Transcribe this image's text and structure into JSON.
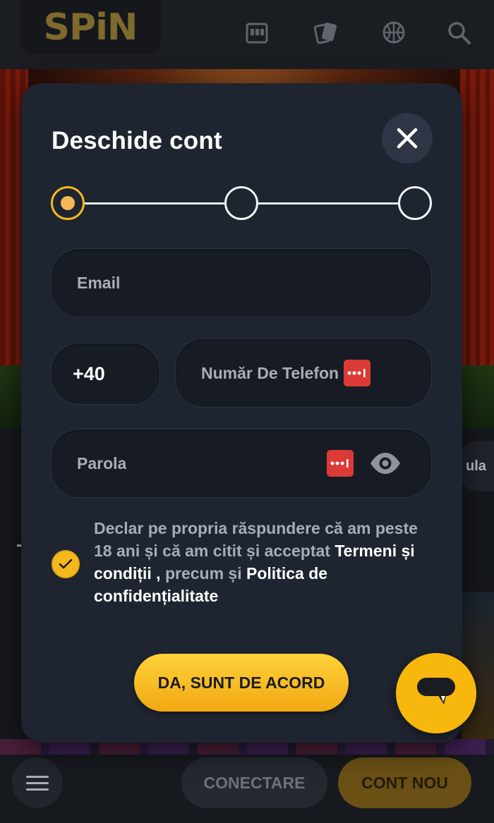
{
  "brand": {
    "logo_text": "SPiN"
  },
  "topbar": {
    "icons": [
      "slot-machine-icon",
      "cards-icon",
      "basketball-icon",
      "search-icon"
    ]
  },
  "modal": {
    "title": "Deschide cont",
    "stepper": {
      "current_step": 1,
      "total_steps": 3
    },
    "email": {
      "placeholder": "Email"
    },
    "phone": {
      "country_code": "+40",
      "placeholder": "Număr De Telefon"
    },
    "password": {
      "placeholder": "Parola"
    },
    "consent": {
      "checked": true,
      "text_before": "Declar pe propria răspundere că am peste 18 ani și că am citit și acceptat ",
      "terms_link": "Termeni și condiții ,",
      "text_middle": " precum și ",
      "privacy_link": "Politica de confidențialitate"
    },
    "agree_button": "DA, SUNT DE ACORD"
  },
  "background": {
    "side_peek_text": "ula"
  },
  "bottombar": {
    "login_button": "CONECTARE",
    "new_account_button": "CONT NOU"
  },
  "colors": {
    "accent": "#f5b91c",
    "modal_bg": "#1e2430",
    "field_bg": "#161b24",
    "password_manager_badge": "#dc3a36"
  }
}
